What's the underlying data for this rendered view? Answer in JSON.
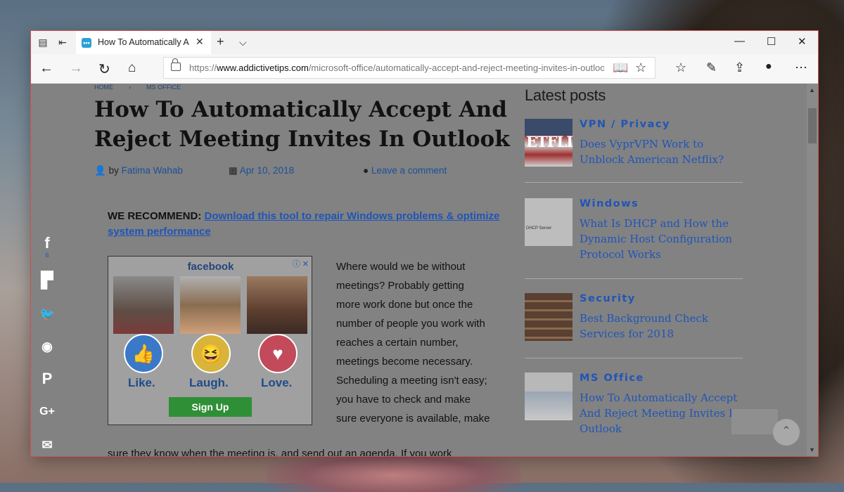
{
  "browser": {
    "tab_title": "How To Automatically A",
    "tab_favicon": "•••",
    "url_prefix": "https://",
    "url_host": "www.addictivetips.com",
    "url_path": "/microsoft-office/automatically-accept-and-reject-meeting-invites-in-outlook/"
  },
  "page": {
    "breadcrumb": [
      "HOME",
      "MS OFFICE"
    ],
    "title": "How To Automatically Accept And Reject Meeting Invites In Outlook",
    "meta": {
      "by": "by",
      "author": "Fatima Wahab",
      "date": "Apr 10, 2018",
      "comment": "Leave a comment"
    },
    "recommend_label": "WE RECOMMEND:",
    "recommend_link": "Download this tool to repair Windows problems & optimize system performance",
    "share_count": "6",
    "ad": {
      "brand": "facebook",
      "labels": [
        "Like.",
        "Laugh.",
        "Love."
      ],
      "button": "Sign Up"
    },
    "body_text": "Where would we be without meetings? Probably getting more work done but once the number of people you work with reaches a certain number, meetings become necessary. Scheduling a meeting isn't easy; you have to check and make sure everyone is available, make",
    "body_cut": "sure they know when the meeting is, and send out an agenda. If you work"
  },
  "sidebar": {
    "heading": "Latest posts",
    "posts": [
      {
        "category": "VPN / Privacy",
        "title": "Does VyprVPN Work to Unblock American Netflix?",
        "thumb_text": "ETFLI"
      },
      {
        "category": "Windows",
        "title": "What Is DHCP and How the Dynamic Host Configuration Protocol Works",
        "thumb_text": "DHCP Server"
      },
      {
        "category": "Security",
        "title": "Best Background Check Services for 2018",
        "thumb_text": ""
      },
      {
        "category": "MS Office",
        "title": "How To Automatically Accept And Reject Meeting Invites In Outlook",
        "thumb_text": ""
      }
    ]
  },
  "icons": {
    "tabs_aside": "tabs-aside-icon",
    "back": "back-arrow-icon",
    "forward": "forward-arrow-icon",
    "refresh": "refresh-icon",
    "home": "home-icon",
    "reading_view": "reading-view-icon",
    "favorite": "star-icon",
    "hub": "favorites-hub-icon",
    "notes": "pen-icon",
    "share": "share-icon",
    "more": "more-icon"
  },
  "colors": {
    "link": "#1f55b8",
    "page_overlay": "#828282",
    "facebook_green": "#2f8f36"
  }
}
